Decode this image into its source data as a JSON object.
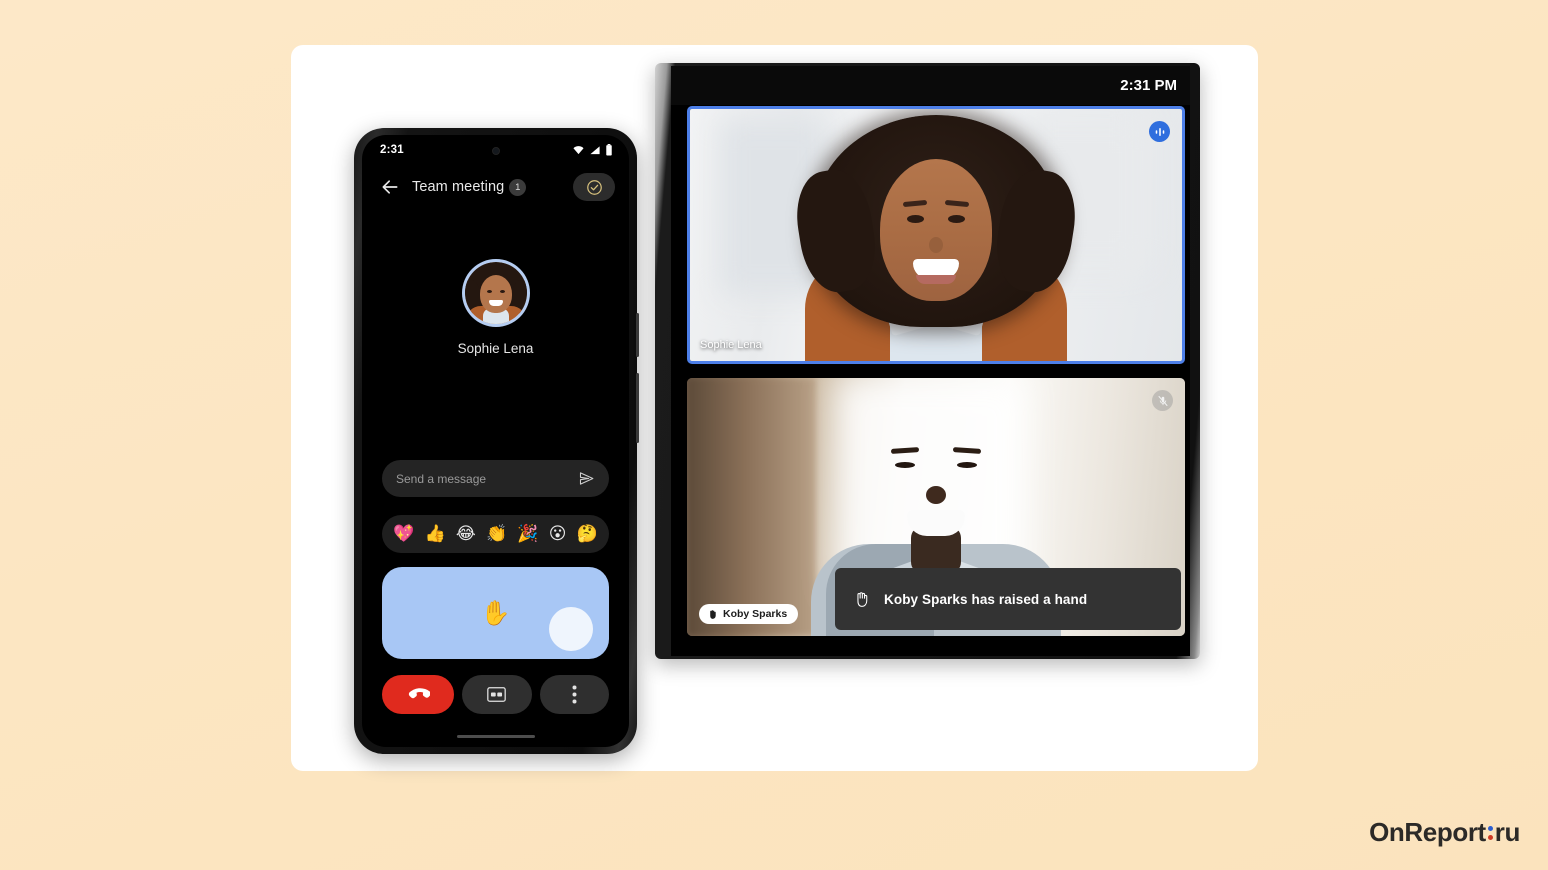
{
  "background": {
    "color": "#fce6c2",
    "card_color": "#ffffff"
  },
  "watermark": {
    "part1": "OnReport",
    "part2": "ru",
    "dot_top_color": "#2e5fd0",
    "dot_bottom_color": "#cf3a25"
  },
  "phone": {
    "status_bar": {
      "time": "2:31",
      "icons": [
        "wifi-icon",
        "cellular-icon",
        "battery-icon"
      ]
    },
    "app_bar": {
      "back_label": "back-arrow-icon",
      "title": "Team meeting",
      "badge_count": "1",
      "action_label": "check-circle-icon"
    },
    "participant": {
      "name": "Sophie Lena",
      "speaking": true
    },
    "composer": {
      "placeholder": "Send a message",
      "value": "",
      "send_label": "send-icon"
    },
    "emoji_bar": [
      "💖",
      "👍",
      "😂",
      "👏",
      "🎉",
      "😮",
      "🤔"
    ],
    "raise_hand": {
      "label": "✋",
      "accent": "#a8c7f5"
    },
    "controls": [
      {
        "name": "end-call-button",
        "icon": "phone-hangup-icon",
        "color": "#e02a1e"
      },
      {
        "name": "captions-button",
        "icon": "closed-captions-icon",
        "color": "#2f2f2f"
      },
      {
        "name": "more-options-button",
        "icon": "more-vertical-icon",
        "color": "#2f2f2f"
      }
    ]
  },
  "tablet": {
    "status_bar": {
      "time": "2:31 PM"
    },
    "tiles": [
      {
        "name": "Sophie Lena",
        "active_speaker": true,
        "border_color": "#4d7fe8",
        "badge": "speaking-indicator-icon"
      },
      {
        "name": "Koby Sparks",
        "active_speaker": false,
        "badge": "microphone-muted-icon",
        "hand_raised": true
      }
    ],
    "notification": {
      "icon": "✋",
      "text": "Koby Sparks has raised a hand"
    }
  }
}
